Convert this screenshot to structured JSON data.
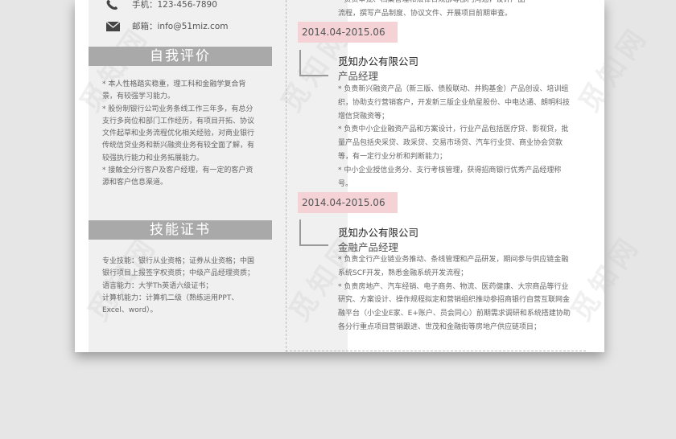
{
  "contact": {
    "phone": "手机：123-456-7890",
    "email": "邮箱：info@51miz.com"
  },
  "self_eval": {
    "title": "自我评价",
    "items": [
      "* 本人性格踏实稳重，理工科和金融学复合背景，有较强学习能力。",
      "* 股份制银行公司业务条线工作三年多，有总分支行多岗位和部门工作经历，有项目开拓、协议文件起草和业务流程优化相关经验，对商业银行传统信贷业务和新兴融资业务有较全面了解，有较强执行能力和业务拓展能力。",
      "* 接触全分行客户及客户经理，有一定的客户资源和客户信息渠道。"
    ]
  },
  "skills": {
    "title": "技能证书",
    "items": [
      "专业技能：银行从业资格；证券从业资格；中国银行项目上报签字权资质；中级产品经理资质；",
      "语言能力：大学Th英语六级证书；",
      "计算机能力：计算机二级（熟练运用PPT、Excel、word）。"
    ]
  },
  "top_text": {
    "line1": "* 负责审批、档案管理和法律合规部等部门沟通，设计产品",
    "line2": "流程，撰写产品制度、协议文件、开展项目前期审查。"
  },
  "jobs": [
    {
      "date": "2014.04-2015.06",
      "company": "觅知办公有限公司",
      "role": "产品经理",
      "items": [
        "* 负责新兴融资产品（新三版、债股联动、井购基金）产品创设、培训组织，协助支行营销客户，开发新三版企业航星股份、中电达通、朗明科技增信贷融资等；",
        "* 负责中小企业融资产品和方案设计，行业产品包括医疗贷、影视贷，批量产品包括央采贷、政采贷、交易市场贷、汽车行业贷、商业协会贷款等，有一定行业分析和判断能力；",
        "* 中小企业授信业务分、支行考核管理，获得招商银行优秀产品经理称号。"
      ]
    },
    {
      "date": "2014.04-2015.06",
      "company": "觅知办公有限公司",
      "role": "金融产品经理",
      "items": [
        "* 负责全行产业链业务推动、条线管理和产品研发，期间参与供应链金融系统SCF开发，熟悉金融系统开发流程；",
        "* 负责房地产、汽车经销、电子商务、物流、医药健康、大宗商品等行业研究、方案设计、操作规程拟定和营销组织推动参招商银行自营互联网金融平台（小企业E家、E+账户、员会同心）前期需求调研和系统搭建协助各分行重点项目营销跟进、世茂和金融街等房地产供应链项目；"
      ]
    }
  ],
  "watermark": "觅知网"
}
